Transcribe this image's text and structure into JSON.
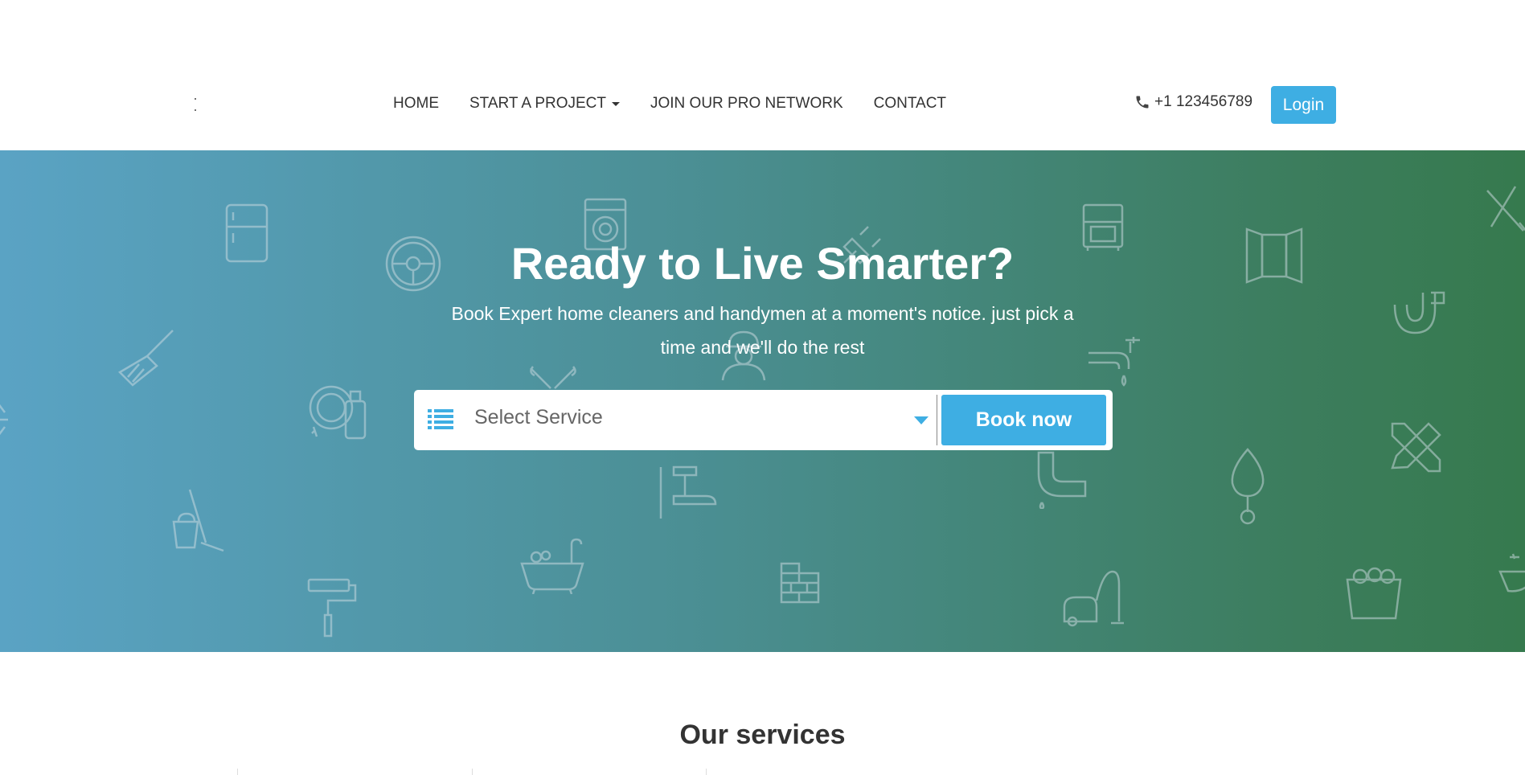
{
  "nav": {
    "items": [
      {
        "label": "HOME"
      },
      {
        "label": "START A PROJECT",
        "dropdown": true
      },
      {
        "label": "JOIN OUR PRO NETWORK"
      },
      {
        "label": "CONTACT"
      }
    ]
  },
  "header": {
    "phone": "+1 123456789",
    "login_label": "Login"
  },
  "hero": {
    "title": "Ready to Live Smarter?",
    "subtitle": "Book Expert home cleaners and handymen at a moment's notice. just pick a time and we'll do the rest",
    "select_placeholder": "Select Service",
    "book_label": "Book now"
  },
  "services": {
    "title": "Our services"
  },
  "colors": {
    "accent": "#3eaee3",
    "hero_gradient_start": "#5aa3c4",
    "hero_gradient_end": "#367a4e",
    "text": "#333333"
  },
  "icons": [
    "phone-icon",
    "list-icon",
    "caret-down-icon",
    "fridge-icon",
    "washing-machine-icon",
    "plug-icon",
    "cabinet-icon",
    "window-icon",
    "tools-icon",
    "steering-wheel-icon",
    "broom-icon",
    "dish-soap-icon",
    "wrench-screwdriver-icon",
    "worker-icon",
    "faucet-icon",
    "pipe-icon",
    "mop-bucket-icon",
    "hammer-icon",
    "bathtub-icon",
    "bricks-icon",
    "vacuum-icon",
    "trowel-icon",
    "bucket-icon",
    "paint-roller-icon",
    "pencil-ruler-icon"
  ]
}
